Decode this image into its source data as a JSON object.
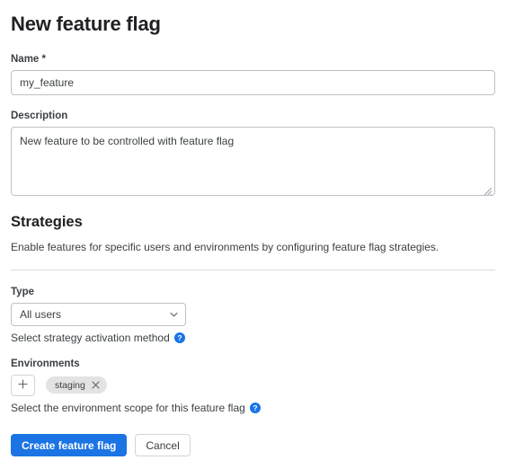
{
  "page": {
    "title": "New feature flag"
  },
  "name_field": {
    "label": "Name *",
    "value": "my_feature",
    "placeholder": ""
  },
  "description_field": {
    "label": "Description",
    "value": "New feature to be controlled with feature flag",
    "placeholder": ""
  },
  "strategies": {
    "title": "Strategies",
    "description": "Enable features for specific users and environments by configuring feature flag strategies.",
    "type": {
      "label": "Type",
      "selected": "All users",
      "options": [
        "All users"
      ],
      "help_text": "Select strategy activation method",
      "help_icon": "help-circle-icon",
      "chevron_icon": "chevron-down-icon"
    },
    "environments": {
      "label": "Environments",
      "add_icon": "plus-icon",
      "chips": [
        {
          "label": "staging",
          "remove_icon": "close-icon"
        }
      ],
      "help_text": "Select the environment scope for this feature flag",
      "help_icon": "help-circle-icon"
    }
  },
  "footer": {
    "submit_label": "Create feature flag",
    "cancel_label": "Cancel"
  },
  "colors": {
    "accent": "#1b74e4",
    "help_icon": "#1a73e8",
    "border": "#bdc1c6",
    "divider": "#dadce0",
    "chip_bg": "#e3e3e3",
    "text": "#3c4043"
  }
}
